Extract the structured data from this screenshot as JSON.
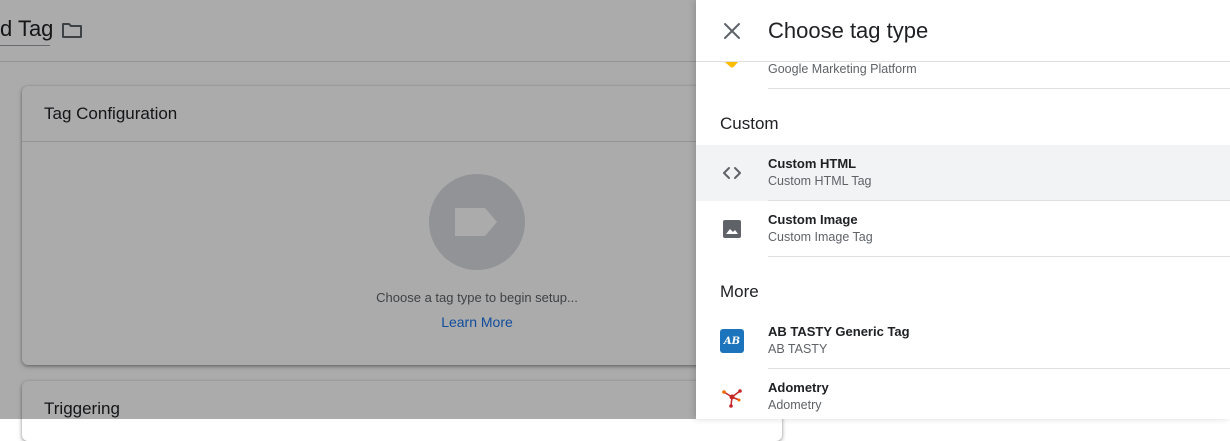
{
  "background": {
    "page_title": "d Tag",
    "tag_configuration": {
      "title": "Tag Configuration",
      "hint": "Choose a tag type to begin setup...",
      "link": "Learn More"
    },
    "triggering": {
      "title": "Triggering"
    }
  },
  "panel": {
    "title": "Choose tag type",
    "partial_row": {
      "subtitle": "Google Marketing Platform"
    },
    "sections": [
      {
        "label": "Custom",
        "items": [
          {
            "name": "Custom HTML",
            "subtitle": "Custom HTML Tag",
            "icon": "code-icon"
          },
          {
            "name": "Custom Image",
            "subtitle": "Custom Image Tag",
            "icon": "image-icon"
          }
        ]
      },
      {
        "label": "More",
        "items": [
          {
            "name": "AB TASTY Generic Tag",
            "subtitle": "AB TASTY",
            "icon": "ab-tasty-logo",
            "logo_text": "AB",
            "logo_color": "#1c75bc"
          },
          {
            "name": "Adometry",
            "subtitle": "Adometry",
            "icon": "adometry-logo"
          }
        ]
      }
    ]
  },
  "colors": {
    "accent": "#1a73e8",
    "highlight_row": "#f1f3f4",
    "gmp_logo": "#fbbc04"
  }
}
